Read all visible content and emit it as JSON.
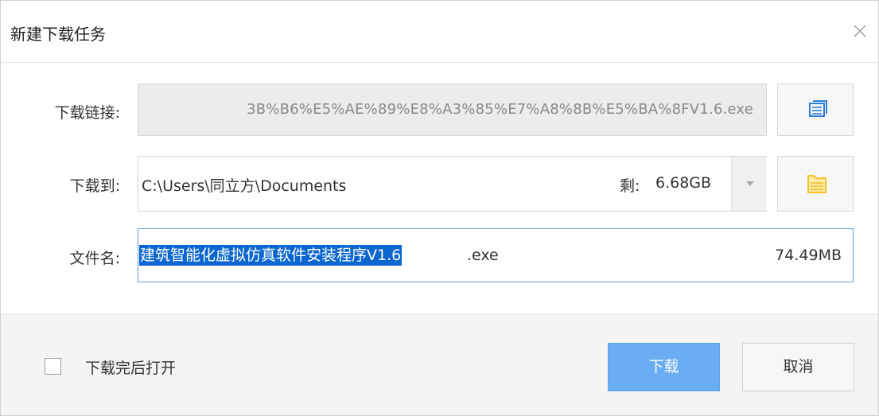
{
  "dialog": {
    "title": "新建下载任务",
    "close_icon": "close-icon"
  },
  "link": {
    "label": "下载链接:",
    "value": "3B%B6%E5%AE%89%E8%A3%85%E7%A8%8B%E5%BA%8FV1.6.exe",
    "button_icon": "paste-icon"
  },
  "destination": {
    "label": "下载到:",
    "path": "C:\\Users\\同立方\\Documents",
    "free_label": "剩:",
    "free_value": "6.68GB",
    "dropdown_icon": "chevron-down-icon",
    "button_icon": "folder-icon"
  },
  "file": {
    "label": "文件名:",
    "name_selected": "建筑智能化虚拟仿真软件安装程序V1.6",
    "extension": ".exe",
    "size": "74.49MB"
  },
  "footer": {
    "open_after_label": "下载完后打开",
    "open_after_checked": false,
    "download_label": "下载",
    "cancel_label": "取消"
  },
  "colors": {
    "accent": "#6aadf2",
    "selection": "#0a66d0",
    "icon_blue": "#2f7fd6",
    "icon_yellow": "#f2c12e"
  }
}
